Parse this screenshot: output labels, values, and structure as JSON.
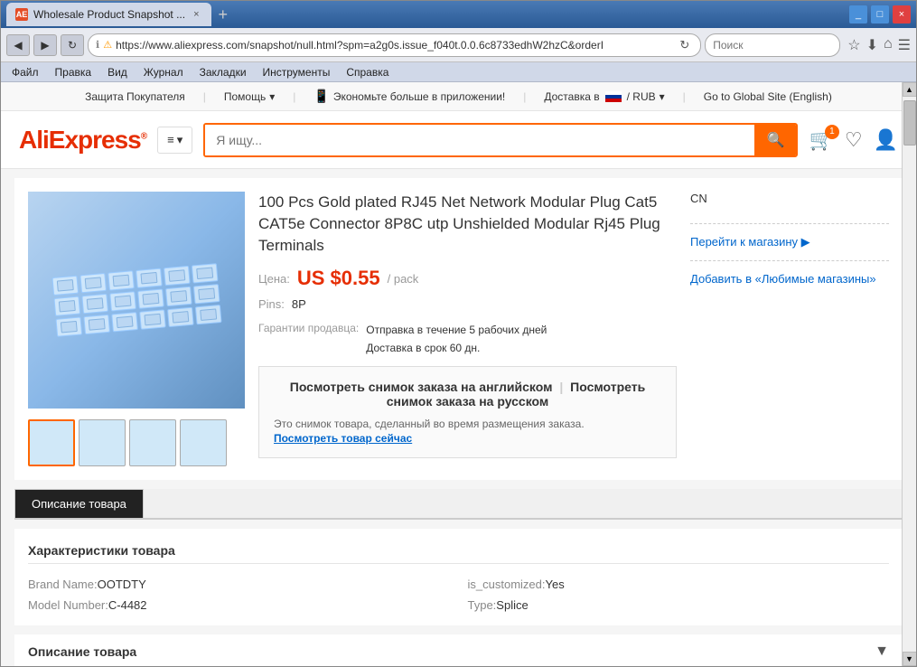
{
  "browser": {
    "title": "Wholesale Product Snapshot ...",
    "tab_favicon": "AE",
    "close_label": "×",
    "new_tab": "+",
    "url": "https://www.aliexpress.com/snapshot/null.html?spm=a2g0s.issue_f040t.0.0.6c8733edhW2hzC&orderI",
    "search_placeholder": "Поиск",
    "window_min": "_",
    "window_max": "□",
    "window_close": "×"
  },
  "menu": {
    "items": [
      "Файл",
      "Правка",
      "Вид",
      "Журнал",
      "Закладки",
      "Инструменты",
      "Справка"
    ]
  },
  "utility_bar": {
    "buyer_protection": "Защита Покупателя",
    "help": "Помощь",
    "help_arrow": "▾",
    "app_promo": "Экономьте больше в приложении!",
    "delivery": "Доставка в",
    "currency": "/ RUB",
    "currency_arrow": "▾",
    "global_site": "Go to Global Site (English)"
  },
  "header": {
    "logo": "AliExpress",
    "logo_superscript": "®",
    "category_label": "≡▾",
    "search_placeholder": "Я ищу...",
    "cart_count": "1",
    "search_icon": "🔍"
  },
  "product": {
    "title": "100 Pcs Gold plated RJ45 Net Network Modular Plug Cat5 CAT5e Connector 8P8C utp Unshielded Modular Rj45 Plug Terminals",
    "price_label": "Цена:",
    "price": "US $0.55",
    "price_unit": "/ pack",
    "pins_label": "Pins:",
    "pins_value": "8P",
    "guarantee_label": "Гарантии продавца:",
    "guarantee_text1": "Отправка в течение 5 рабочих дней",
    "guarantee_text2": "Доставка в срок 60 дн.",
    "snapshot_link_en": "Посмотреть снимок заказа на английском",
    "snapshot_divider": "|",
    "snapshot_link_ru": "Посмотреть снимок заказа на русском",
    "snapshot_note": "Это снимок товара, сделанный во время размещения заказа.",
    "snapshot_view_now": "Посмотреть товар сейчас"
  },
  "sidebar": {
    "country": "CN",
    "store_link": "Перейти к магазину ▶",
    "fav_link": "Добавить в «Любимые магазины»"
  },
  "tabs": {
    "description": "Описание товара"
  },
  "characteristics": {
    "title": "Характеристики товара",
    "brand_label": "Brand Name:",
    "brand_value": "OOTDTY",
    "model_label": "Model Number:",
    "model_value": "C-4482",
    "customized_label": "is_customized:",
    "customized_value": "Yes",
    "type_label": "Type:",
    "type_value": "Splice"
  },
  "description": {
    "title": "Описание товара"
  },
  "scrollbar": {
    "up": "▲",
    "down": "▼"
  }
}
